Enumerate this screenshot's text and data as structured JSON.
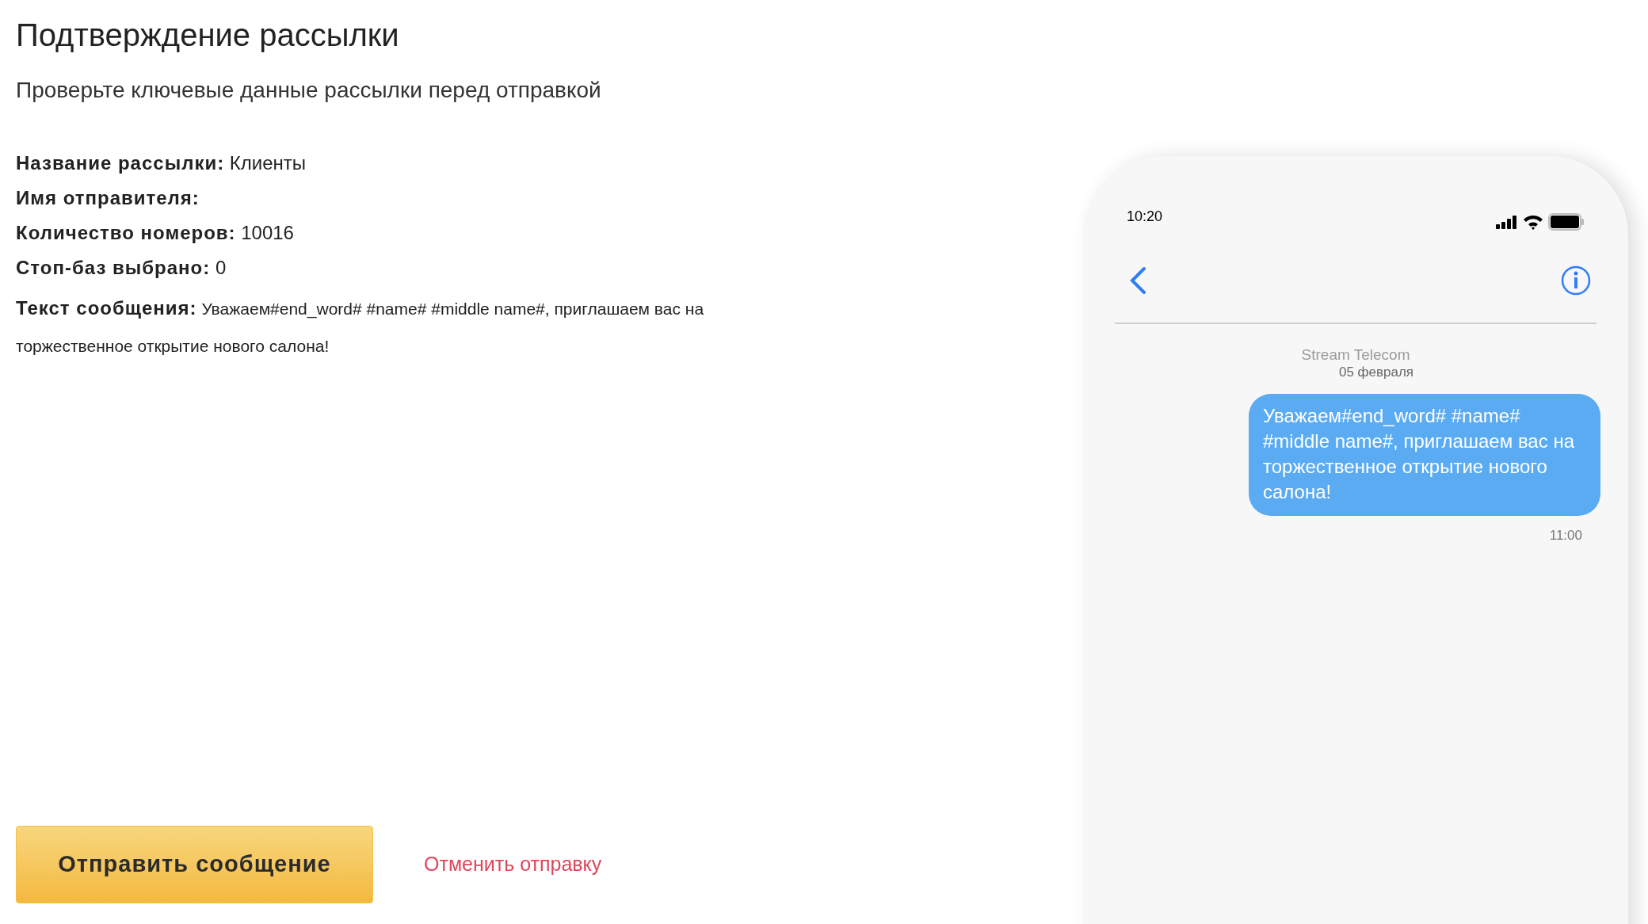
{
  "title": "Подтверждение рассылки",
  "subtitle": "Проверьте ключевые данные рассылки перед отправкой",
  "details": [
    {
      "label": "Название рассылки:",
      "value": "Клиенты"
    },
    {
      "label": "Имя отправителя:"
    },
    {
      "label": "Количество номеров:",
      "value": "10016"
    },
    {
      "label": "Стоп-баз выбрано:",
      "value": "0"
    },
    {
      "label": "Текст сообщения:",
      "value": "Уважаем#end_word# #name# #middle name#, приглашаем вас на торжественное открытие нового салона!",
      "kind": "message"
    }
  ],
  "send_button": "Отправить сообщение",
  "cancel_link": "Отменить отправку",
  "phone": {
    "time": "10:20",
    "sender": "Stream Telecom",
    "date": "05 февраля",
    "message": "Уважаем#end_word# #name# #middle name#, приглашаем вас на торжественное открытие нового салона!",
    "message_time": "11:00"
  }
}
